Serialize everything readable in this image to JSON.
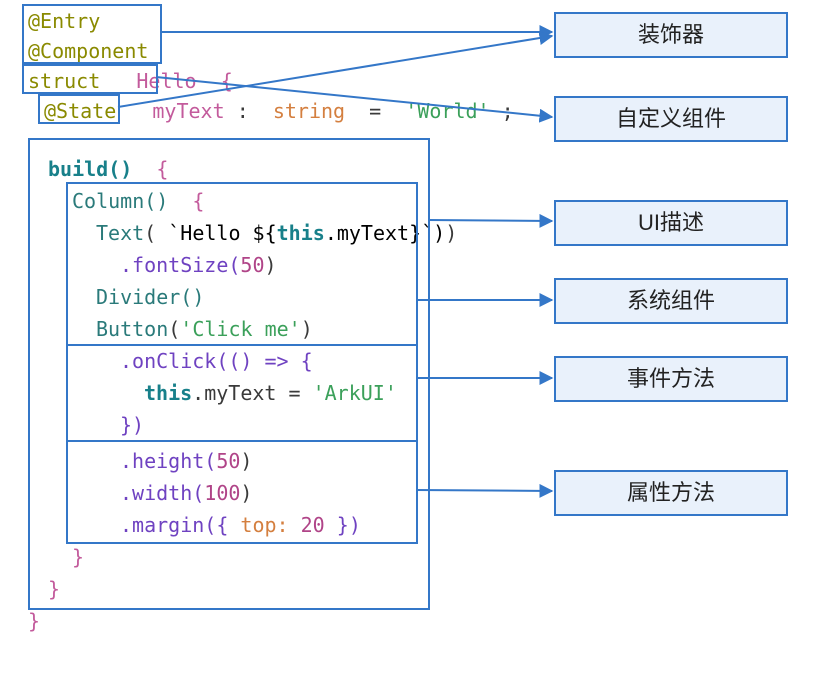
{
  "code": {
    "entry": "@Entry",
    "component": "@Component",
    "struct_kw": "struct",
    "struct_nm": "Hello",
    "state_kw": "@State",
    "state_nm": "myText",
    "state_ty": "string",
    "state_val": "'World'",
    "build": "build()",
    "col": "Column()",
    "text_open": "Text(`Hello ${",
    "text_this": "this",
    "text_mid": ".myText}`)",
    "fontsize": ".fontSize(",
    "fifty": "50",
    "divider": "Divider()",
    "button": "Button(",
    "click_me": "'Click me'",
    "onclick": ".onClick(() => {",
    "assign_l": "this",
    "assign_m": ".myText = ",
    "assign_r": "'ArkUI'",
    "onclick_e": "})",
    "height": ".height(",
    "width": ".width(",
    "hundred": "100",
    "margin": ".margin({ ",
    "top_kw": "top:",
    "twenty": "20",
    "margin_e": " })"
  },
  "labels": {
    "decorator": "装饰器",
    "custom": "自定义组件",
    "ui": "UI描述",
    "sys": "系统组件",
    "event": "事件方法",
    "attr": "属性方法"
  }
}
